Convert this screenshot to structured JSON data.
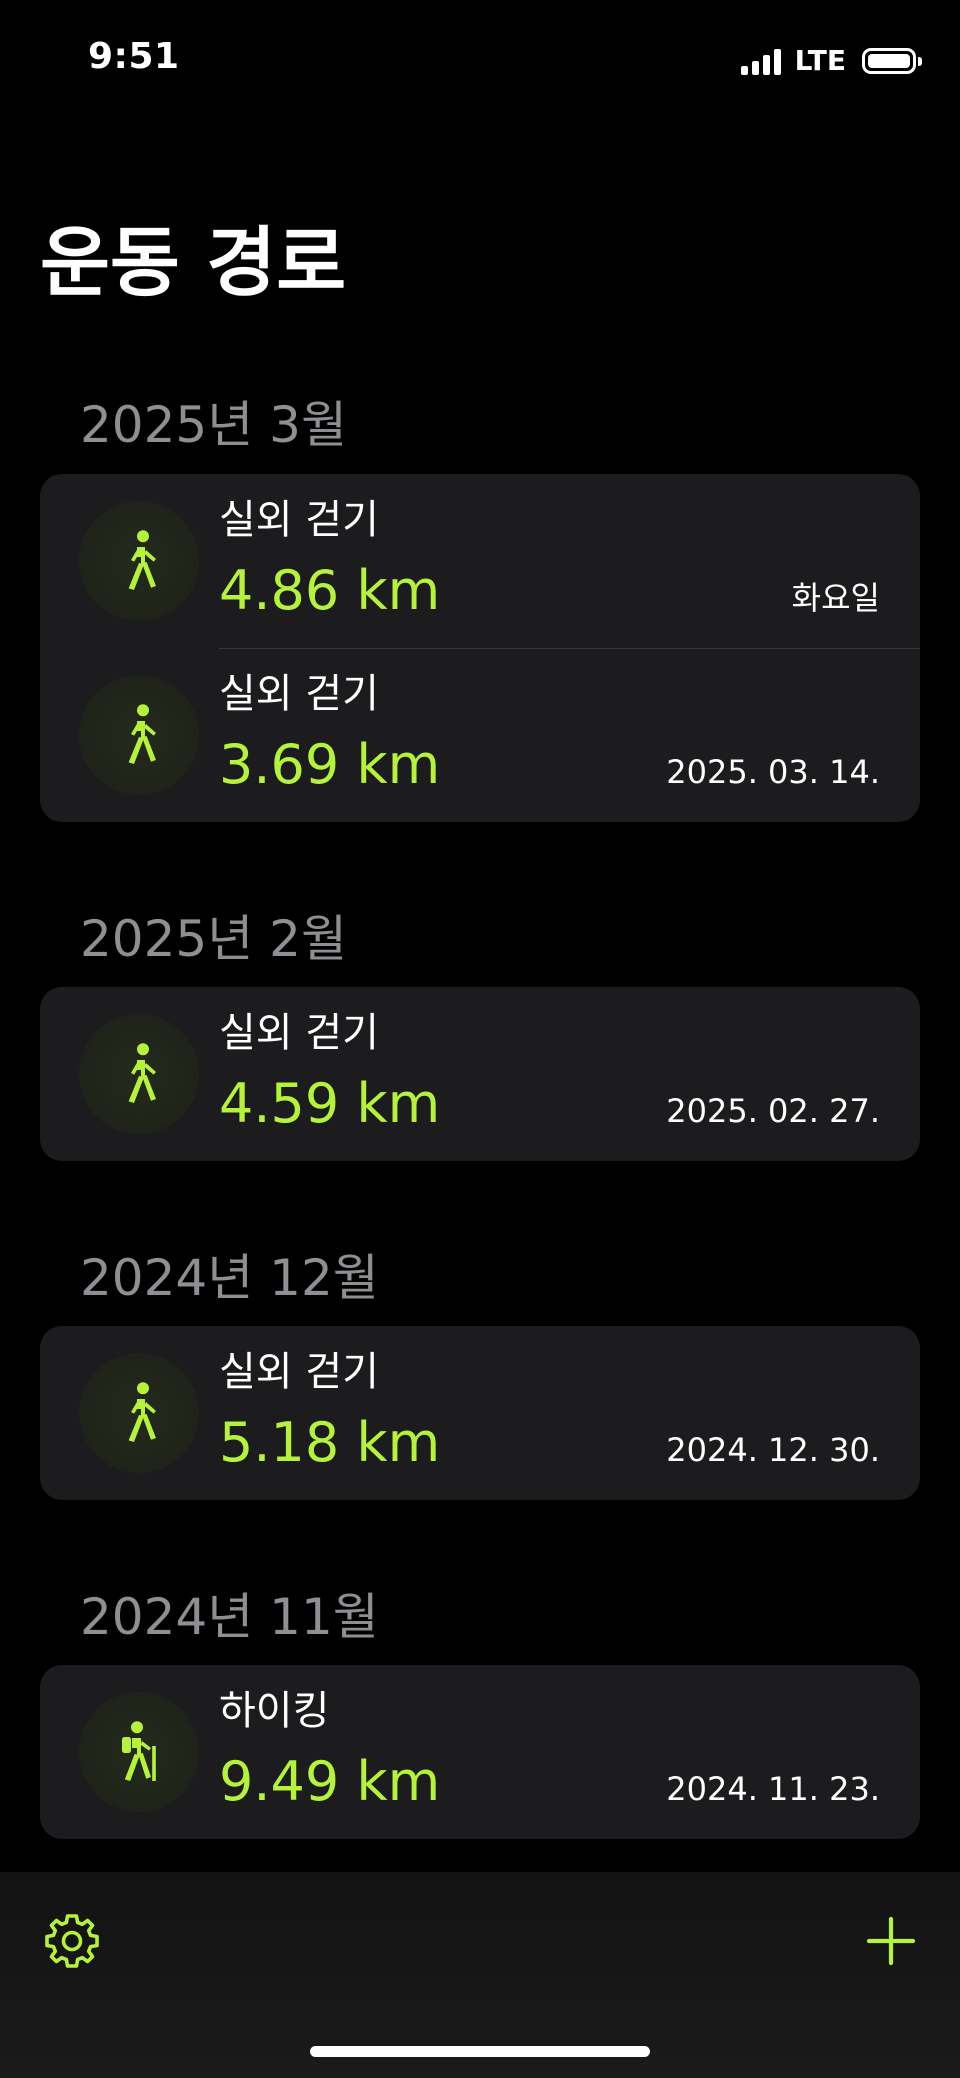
{
  "status_bar": {
    "time": "9:51",
    "carrier": "LTE",
    "icons": [
      "signal-icon",
      "battery-icon"
    ]
  },
  "title": "운동 경로",
  "accent_color": "#b5f23a",
  "sections": [
    {
      "header": "2025년 3월",
      "items": [
        {
          "activity": "실외 걷기",
          "distance": "4.86 km",
          "date": "화요일",
          "icon": "walking-icon"
        },
        {
          "activity": "실외 걷기",
          "distance": "3.69 km",
          "date": "2025. 03. 14.",
          "icon": "walking-icon"
        }
      ]
    },
    {
      "header": "2025년 2월",
      "items": [
        {
          "activity": "실외 걷기",
          "distance": "4.59 km",
          "date": "2025. 02. 27.",
          "icon": "walking-icon"
        }
      ]
    },
    {
      "header": "2024년 12월",
      "items": [
        {
          "activity": "실외 걷기",
          "distance": "5.18 km",
          "date": "2024. 12. 30.",
          "icon": "walking-icon"
        }
      ]
    },
    {
      "header": "2024년 11월",
      "items": [
        {
          "activity": "하이킹",
          "distance": "9.49 km",
          "date": "2024. 11. 23.",
          "icon": "hiking-icon"
        }
      ]
    }
  ],
  "toolbar": {
    "left_icon": "gear-icon",
    "right_icon": "plus-icon"
  }
}
